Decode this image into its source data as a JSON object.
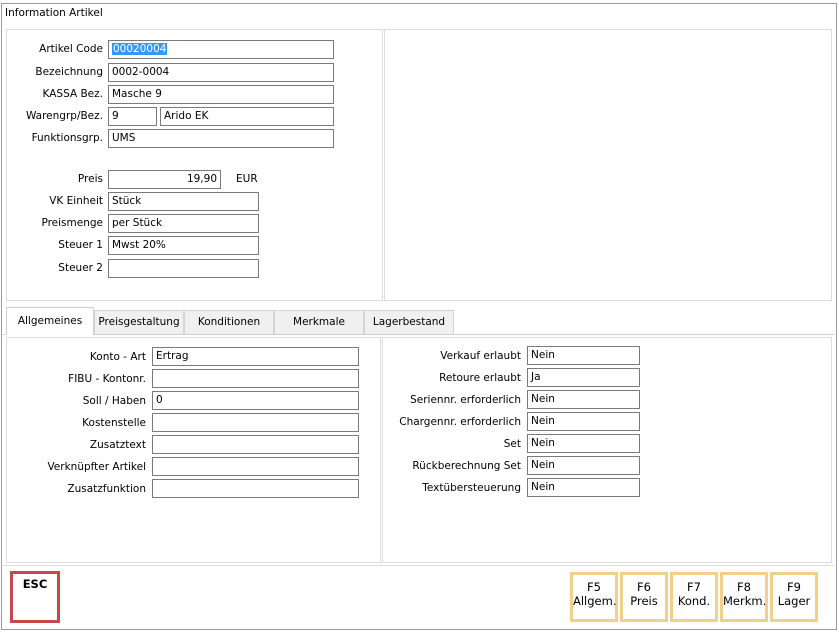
{
  "window": {
    "title": "Information Artikel"
  },
  "artikel": {
    "code_label": "Artikel Code",
    "code_value": "00020004",
    "bez_label": "Bezeichnung",
    "bez_value": "0002-0004",
    "kassa_label": "KASSA Bez.",
    "kassa_value": "Masche 9",
    "warengrp_label": "Warengrp/Bez.",
    "warengrp_num": "9",
    "warengrp_name": "Arido EK",
    "funktion_label": "Funktionsgrp.",
    "funktion_value": "UMS",
    "preis_label": "Preis",
    "preis_value": "19,90",
    "currency": "EUR",
    "vk_label": "VK Einheit",
    "vk_value": "Stück",
    "menge_label": "Preismenge",
    "menge_value": "per Stück",
    "steuer1_label": "Steuer 1",
    "steuer1_value": "Mwst 20%",
    "steuer2_label": "Steuer 2",
    "steuer2_value": ""
  },
  "tabs": [
    {
      "label": "Allgemeines"
    },
    {
      "label": "Preisgestaltung"
    },
    {
      "label": "Konditionen"
    },
    {
      "label": "Merkmale"
    },
    {
      "label": "Lagerbestand"
    }
  ],
  "allgemein_left": [
    {
      "label": "Konto - Art",
      "value": "Ertrag"
    },
    {
      "label": "FIBU - Kontonr.",
      "value": ""
    },
    {
      "label": "Soll / Haben",
      "value": "0"
    },
    {
      "label": "Kostenstelle",
      "value": ""
    },
    {
      "label": "Zusatztext",
      "value": ""
    },
    {
      "label": "Verknüpfter Artikel",
      "value": ""
    },
    {
      "label": "Zusatzfunktion",
      "value": ""
    }
  ],
  "allgemein_right": [
    {
      "label": "Verkauf erlaubt",
      "value": "Nein"
    },
    {
      "label": "Retoure erlaubt",
      "value": "Ja"
    },
    {
      "label": "Seriennr. erforderlich",
      "value": "Nein"
    },
    {
      "label": "Chargennr. erforderlich",
      "value": "Nein"
    },
    {
      "label": "Set",
      "value": "Nein"
    },
    {
      "label": "Rückberechnung Set",
      "value": "Nein"
    },
    {
      "label": "Textübersteuerung",
      "value": "Nein"
    }
  ],
  "buttons": {
    "esc": "ESC",
    "f5_key": "F5",
    "f5_label": "Allgem.",
    "f6_key": "F6",
    "f6_label": "Preis",
    "f7_key": "F7",
    "f7_label": "Kond.",
    "f8_key": "F8",
    "f8_label": "Merkm.",
    "f9_key": "F9",
    "f9_label": "Lager"
  },
  "colors": {
    "selection": "#3399ff",
    "fkey_border": "#f2cf8b",
    "esc_border": "#c8474b"
  }
}
